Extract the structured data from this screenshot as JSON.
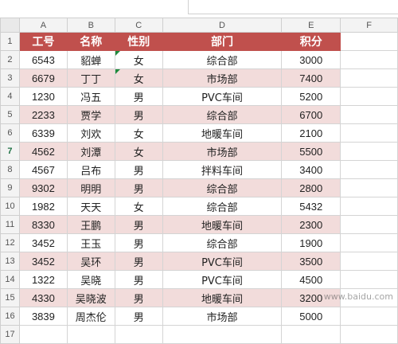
{
  "columns": [
    "A",
    "B",
    "C",
    "D",
    "E",
    "F"
  ],
  "header": [
    "工号",
    "名称",
    "性别",
    "部门",
    "积分"
  ],
  "rows": [
    [
      "6543",
      "貂蝉",
      "女",
      "综合部",
      "3000"
    ],
    [
      "6679",
      "丁丁",
      "女",
      "市场部",
      "7400"
    ],
    [
      "1230",
      "冯五",
      "男",
      "PVC车间",
      "5200"
    ],
    [
      "2233",
      "贾学",
      "男",
      "综合部",
      "6700"
    ],
    [
      "6339",
      "刘欢",
      "女",
      "地暖车间",
      "2100"
    ],
    [
      "4562",
      "刘潭",
      "女",
      "市场部",
      "5500"
    ],
    [
      "4567",
      "吕布",
      "男",
      "拌料车间",
      "3400"
    ],
    [
      "9302",
      "明明",
      "男",
      "综合部",
      "2800"
    ],
    [
      "1982",
      "天天",
      "女",
      "综合部",
      "5432"
    ],
    [
      "8330",
      "王鹏",
      "男",
      "地暖车间",
      "2300"
    ],
    [
      "3452",
      "王玉",
      "男",
      "综合部",
      "1900"
    ],
    [
      "3452",
      "吴环",
      "男",
      "PVC车间",
      "3500"
    ],
    [
      "1322",
      "吴晓",
      "男",
      "PVC车间",
      "4500"
    ],
    [
      "4330",
      "吴晓波",
      "男",
      "地暖车间",
      "3200"
    ],
    [
      "3839",
      "周杰伦",
      "男",
      "市场部",
      "5000"
    ]
  ],
  "row_numbers": [
    "1",
    "2",
    "3",
    "4",
    "5",
    "6",
    "7",
    "8",
    "9",
    "10",
    "11",
    "12",
    "13",
    "14",
    "15",
    "16",
    "17"
  ],
  "active_row": "7",
  "colors": {
    "header_bg": "#c0504d",
    "band_bg": "#f2dcdb"
  }
}
